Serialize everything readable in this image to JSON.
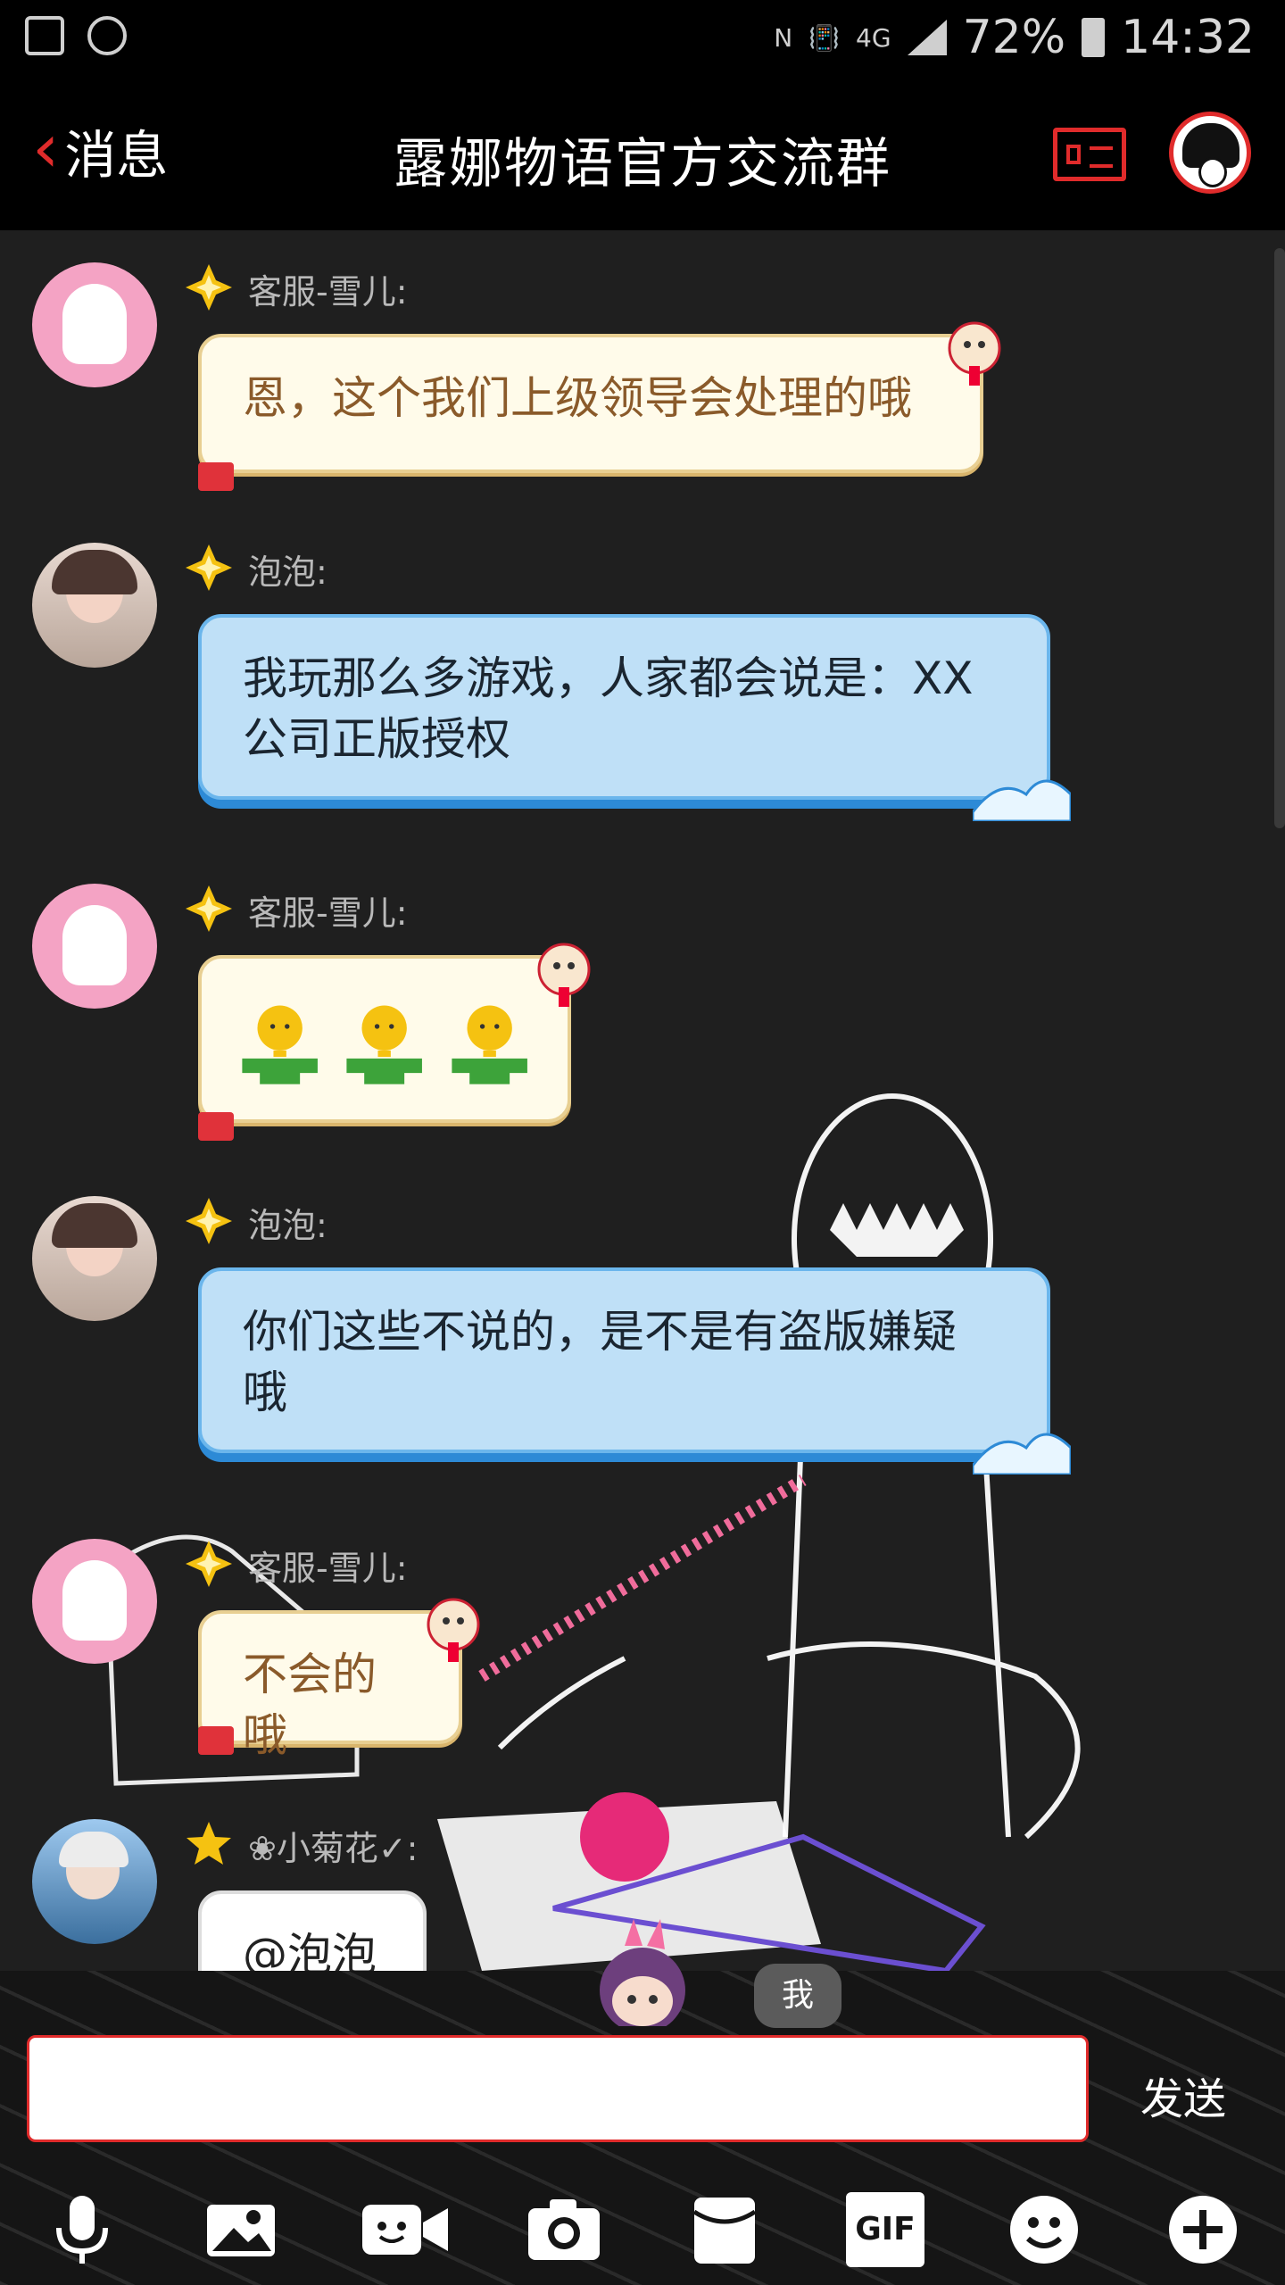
{
  "status_bar": {
    "network": "4G",
    "battery": "72%",
    "time": "14:32",
    "icons": [
      "gallery-icon",
      "alarm-icon",
      "nfc-icon",
      "vibrate-icon",
      "signal-icon",
      "battery-icon"
    ]
  },
  "header": {
    "back_label": "消息",
    "title": "露娜物语官方交流群",
    "icons": [
      "back-chevron-icon",
      "group-card-icon",
      "group-avatar-icon"
    ]
  },
  "messages": [
    {
      "sender": "客服-雪儿:",
      "text": "恩，这个我们上级领导会处理的哦",
      "style": "cream",
      "avatar": "pink-avatar",
      "badge": "gold-diamond-icon"
    },
    {
      "sender": "泡泡:",
      "text": "我玩那么多游戏，人家都会说是：XX\n公司正版授权",
      "style": "blue",
      "avatar": "girl-avatar",
      "badge": "gold-diamond-icon"
    },
    {
      "sender": "客服-雪儿:",
      "text": "",
      "emoji": [
        "person-emoji",
        "person-emoji",
        "person-emoji"
      ],
      "style": "cream",
      "avatar": "pink-avatar",
      "badge": "gold-diamond-icon"
    },
    {
      "sender": "泡泡:",
      "text": "你们这些不说的，是不是有盗版嫌疑\n哦",
      "style": "blue",
      "avatar": "girl-avatar",
      "badge": "gold-diamond-icon"
    },
    {
      "sender": "客服-雪儿:",
      "text": "不会的哦",
      "style": "cream",
      "avatar": "pink-avatar",
      "badge": "gold-diamond-icon"
    },
    {
      "sender": "❀小菊花✓:",
      "text": "@泡泡",
      "style": "white",
      "avatar": "blue-avatar",
      "badge": "gold-star-icon"
    }
  ],
  "me_tag": "我",
  "composer": {
    "input_value": "",
    "send_label": "发送"
  },
  "toolbar": [
    {
      "name": "voice-button",
      "icon": "microphone-icon"
    },
    {
      "name": "photo-album-button",
      "icon": "landscape-icon"
    },
    {
      "name": "video-call-button",
      "icon": "video-camera-icon"
    },
    {
      "name": "camera-button",
      "icon": "camera-icon"
    },
    {
      "name": "red-packet-button",
      "icon": "envelope-icon"
    },
    {
      "name": "gif-button",
      "icon": "gif-icon",
      "label": "GIF"
    },
    {
      "name": "emoji-button",
      "icon": "smiley-icon"
    },
    {
      "name": "more-button",
      "icon": "plus-icon"
    }
  ],
  "colors": {
    "accent": "#e02b2b",
    "cream_bubble": "#fffbea",
    "blue_bubble": "#bfe0f7",
    "chat_bg": "#1f1f1f"
  }
}
